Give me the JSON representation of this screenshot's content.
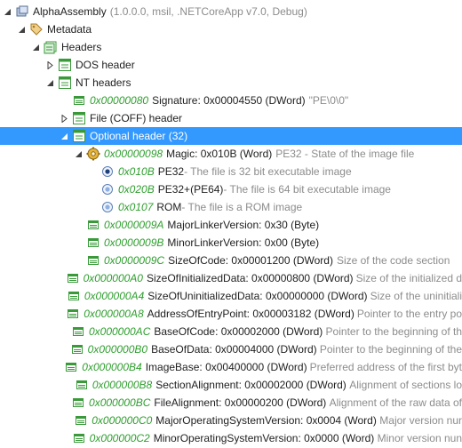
{
  "colors": {
    "selection": "#3399ff",
    "offset": "#2e9e2e",
    "comment": "#8c8c8c",
    "icon_green": "#3a9a3a"
  },
  "tree": {
    "assembly": {
      "label": "AlphaAssembly",
      "detail": "(1.0.0.0, msil, .NETCoreApp v7.0, Debug)",
      "icon": "assembly-icon"
    },
    "metadata": {
      "label": "Metadata",
      "icon": "tag-icon"
    },
    "headers": {
      "label": "Headers",
      "icon": "folder-green-icon"
    },
    "dos_header": {
      "label": "DOS header",
      "icon": "green-struct-icon"
    },
    "nt_headers": {
      "label": "NT headers",
      "icon": "green-struct-icon"
    },
    "signature": {
      "offset": "0x00000080",
      "label": "Signature: 0x00004550 (DWord)",
      "comment": "\"PE\\0\\0\""
    },
    "file_header": {
      "label": "File (COFF) header",
      "icon": "green-struct-icon"
    },
    "optional_header": {
      "label": "Optional header (32)",
      "icon": "green-struct-icon"
    },
    "magic": {
      "offset": "0x00000098",
      "label": "Magic: 0x010B (Word)",
      "comment": "PE32 - State of the image file",
      "icon": "gear-icon"
    },
    "magic_options": [
      {
        "offset": "0x010B",
        "label": "PE32",
        "comment": " - The file is 32 bit executable image",
        "selected": true
      },
      {
        "offset": "0x020B",
        "label": "PE32+(PE64)",
        "comment": " - The file is 64 bit executable image",
        "selected": false
      },
      {
        "offset": "0x0107",
        "label": "ROM",
        "comment": " - The file is a ROM image",
        "selected": false
      }
    ],
    "fields": [
      {
        "offset": "0x0000009A",
        "label": "MajorLinkerVersion: 0x30 (Byte)",
        "comment": ""
      },
      {
        "offset": "0x0000009B",
        "label": "MinorLinkerVersion: 0x00 (Byte)",
        "comment": ""
      },
      {
        "offset": "0x0000009C",
        "label": "SizeOfCode: 0x00001200 (DWord)",
        "comment": "Size of the code section"
      },
      {
        "offset": "0x000000A0",
        "label": "SizeOfInitializedData: 0x00000800 (DWord)",
        "comment": "Size of the initialized d"
      },
      {
        "offset": "0x000000A4",
        "label": "SizeOfUninitializedData: 0x00000000 (DWord)",
        "comment": "Size of the uninitiali"
      },
      {
        "offset": "0x000000A8",
        "label": "AddressOfEntryPoint: 0x00003182 (DWord)",
        "comment": "Pointer to the entry po"
      },
      {
        "offset": "0x000000AC",
        "label": "BaseOfCode: 0x00002000 (DWord)",
        "comment": "Pointer to the beginning of th"
      },
      {
        "offset": "0x000000B0",
        "label": "BaseOfData: 0x00004000 (DWord)",
        "comment": "Pointer to the beginning of the"
      },
      {
        "offset": "0x000000B4",
        "label": "ImageBase: 0x00400000 (DWord)",
        "comment": "Preferred address of the first byt"
      },
      {
        "offset": "0x000000B8",
        "label": "SectionAlignment: 0x00002000 (DWord)",
        "comment": "Alignment of sections lo"
      },
      {
        "offset": "0x000000BC",
        "label": "FileAlignment: 0x00000200 (DWord)",
        "comment": "Alignment of the raw data of"
      },
      {
        "offset": "0x000000C0",
        "label": "MajorOperatingSystemVersion: 0x0004 (Word)",
        "comment": "Major version nur"
      },
      {
        "offset": "0x000000C2",
        "label": "MinorOperatingSystemVersion: 0x0000 (Word)",
        "comment": "Minor version nun"
      }
    ]
  }
}
